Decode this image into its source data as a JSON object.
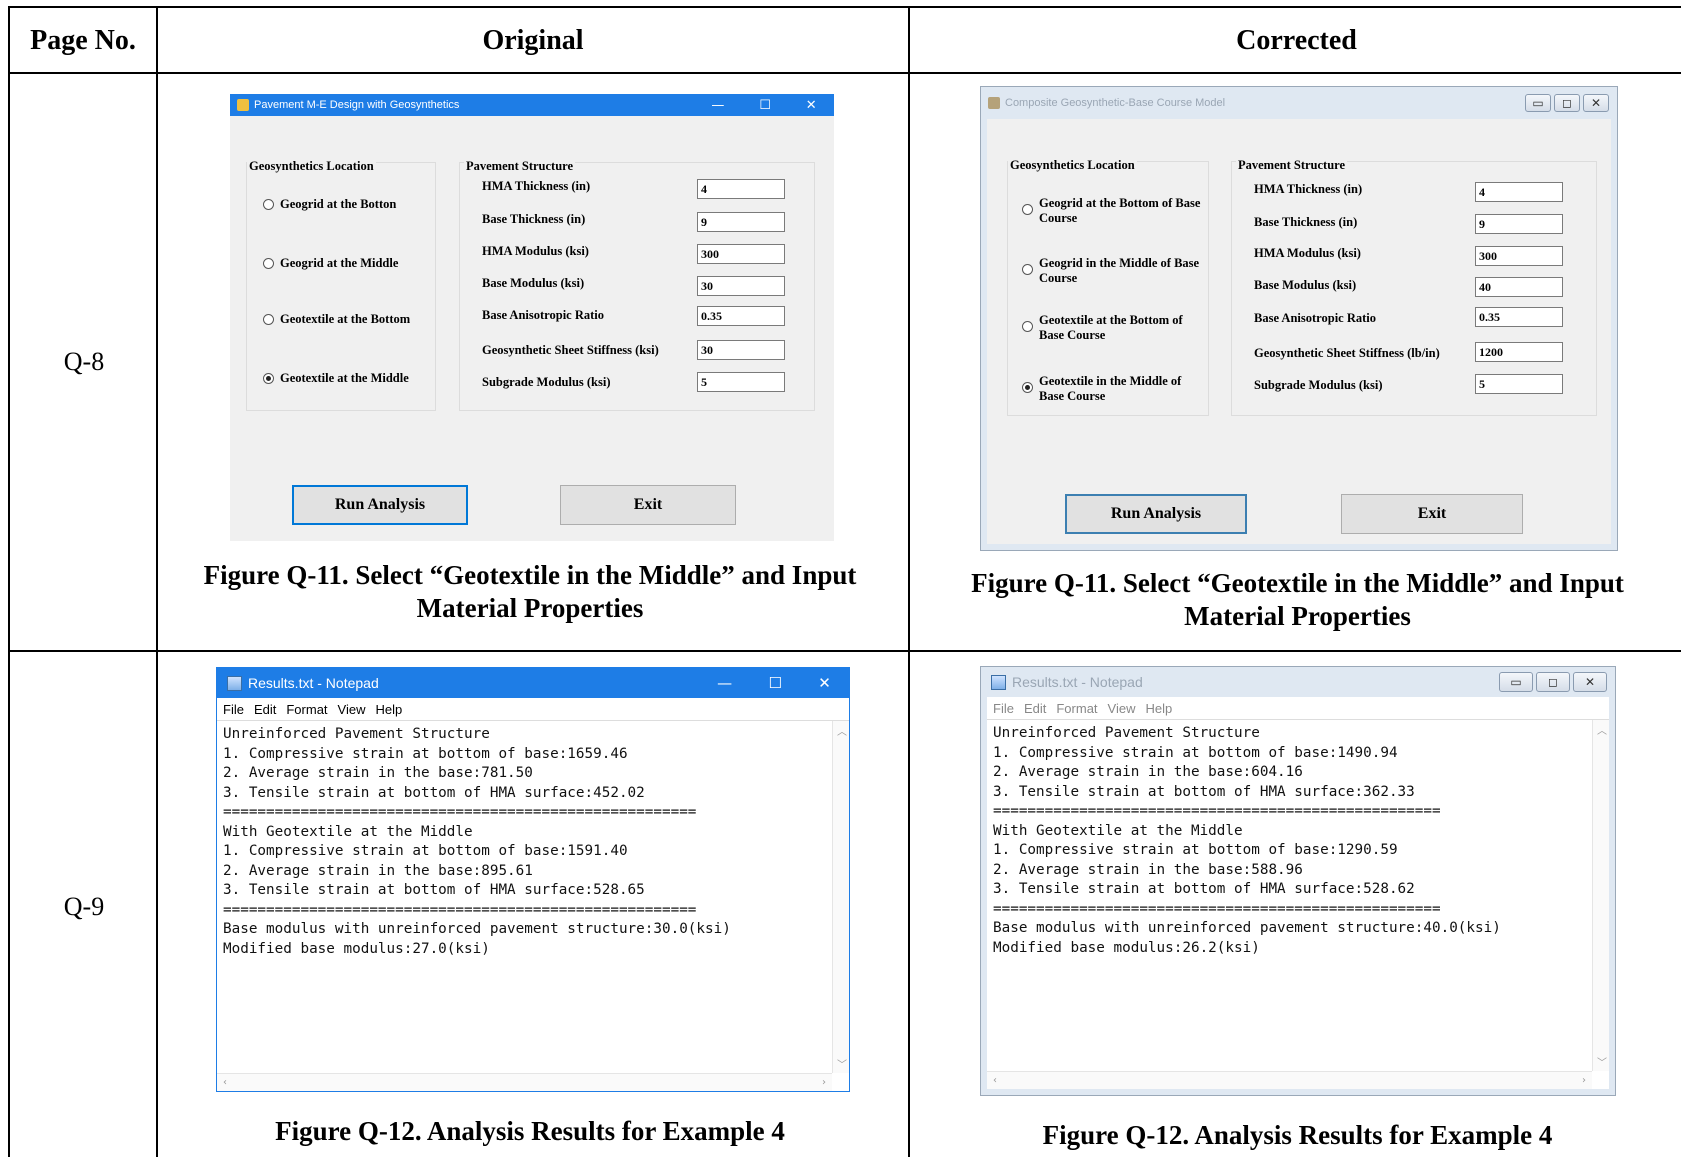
{
  "table": {
    "headers": {
      "page_no": "Page No.",
      "original": "Original",
      "corrected": "Corrected"
    },
    "rows": [
      {
        "page_no": "Q-8",
        "caption_original": "Figure Q-11. Select “Geotextile in the Middle” and Input Material Properties",
        "caption_corrected": "Figure Q-11. Select “Geotextile in the Middle” and Input Material Properties"
      },
      {
        "page_no": "Q-9",
        "caption_original": "Figure Q-12. Analysis Results for Example 4",
        "caption_corrected": "Figure Q-12. Analysis Results for Example 4"
      }
    ]
  },
  "dialog_original": {
    "title": "Pavement M-E Design with Geosynthetics",
    "titlebar_color": "#1e7de6",
    "location_group": "Geosynthetics Location",
    "options": [
      {
        "label": "Geogrid at the Botton",
        "selected": false
      },
      {
        "label": "Geogrid at the Middle",
        "selected": false
      },
      {
        "label": "Geotextile at the Bottom",
        "selected": false
      },
      {
        "label": "Geotextile at the Middle",
        "selected": true
      }
    ],
    "structure_group": "Pavement Structure",
    "fields": [
      {
        "label": "HMA Thickness (in)",
        "value": "4"
      },
      {
        "label": "Base Thickness (in)",
        "value": "9"
      },
      {
        "label": "HMA Modulus (ksi)",
        "value": "300"
      },
      {
        "label": "Base Modulus (ksi)",
        "value": "30"
      },
      {
        "label": "Base Anisotropic Ratio",
        "value": "0.35"
      },
      {
        "label": "Geosynthetic Sheet Stiffness (ksi)",
        "value": "30"
      },
      {
        "label": "Subgrade Modulus (ksi)",
        "value": "5"
      }
    ],
    "run_button": "Run Analysis",
    "exit_button": "Exit",
    "controls": {
      "minimize": "—",
      "maximize": "☐",
      "close": "✕"
    }
  },
  "dialog_corrected": {
    "title": "Composite Geosynthetic-Base Course Model",
    "titlebar_color": "#dfe8f2",
    "location_group": "Geosynthetics Location",
    "options": [
      {
        "label": "Geogrid at the Bottom of Base Course",
        "selected": false
      },
      {
        "label": "Geogrid in the Middle of Base Course",
        "selected": false
      },
      {
        "label": "Geotextile at the Bottom of Base Course",
        "selected": false
      },
      {
        "label": "Geotextile in the Middle of Base Course",
        "selected": true
      }
    ],
    "structure_group": "Pavement Structure",
    "fields": [
      {
        "label": "HMA Thickness (in)",
        "value": "4"
      },
      {
        "label": "Base Thickness (in)",
        "value": "9"
      },
      {
        "label": "HMA Modulus (ksi)",
        "value": "300"
      },
      {
        "label": "Base Modulus (ksi)",
        "value": "40"
      },
      {
        "label": "Base Anisotropic Ratio",
        "value": "0.35"
      },
      {
        "label": "Geosynthetic Sheet Stiffness (lb/in)",
        "value": "1200"
      },
      {
        "label": "Subgrade Modulus (ksi)",
        "value": "5"
      }
    ],
    "run_button": "Run Analysis",
    "exit_button": "Exit",
    "controls": {
      "minimize": "▭",
      "maximize": "◻",
      "close": "✕"
    }
  },
  "notepad_original": {
    "title": "Results.txt - Notepad",
    "menu": [
      "File",
      "Edit",
      "Format",
      "View",
      "Help"
    ],
    "text": "Unreinforced Pavement Structure\n1. Compressive strain at bottom of base:1659.46\n2. Average strain in the base:781.50\n3. Tensile strain at bottom of HMA surface:452.02\n=======================================================\nWith Geotextile at the Middle\n1. Compressive strain at bottom of base:1591.40\n2. Average strain in the base:895.61\n3. Tensile strain at bottom of HMA surface:528.65\n=======================================================\nBase modulus with unreinforced pavement structure:30.0(ksi)\nModified base modulus:27.0(ksi)",
    "controls": {
      "minimize": "—",
      "maximize": "☐",
      "close": "✕"
    }
  },
  "notepad_corrected": {
    "title": "Results.txt - Notepad",
    "menu": [
      "File",
      "Edit",
      "Format",
      "View",
      "Help"
    ],
    "text": "Unreinforced Pavement Structure\n1. Compressive strain at bottom of base:1490.94\n2. Average strain in the base:604.16\n3. Tensile strain at bottom of HMA surface:362.33\n====================================================\nWith Geotextile at the Middle\n1. Compressive strain at bottom of base:1290.59\n2. Average strain in the base:588.96\n3. Tensile strain at bottom of HMA surface:528.62\n====================================================\nBase modulus with unreinforced pavement structure:40.0(ksi)\nModified base modulus:26.2(ksi)",
    "controls": {
      "minimize": "▭",
      "maximize": "◻",
      "close": "✕"
    }
  }
}
